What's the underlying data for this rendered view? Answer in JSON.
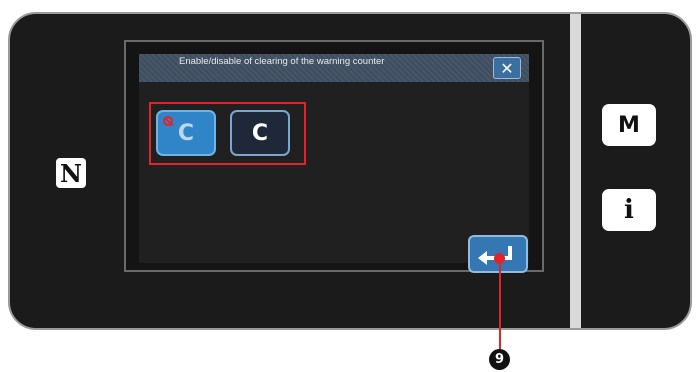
{
  "dialog": {
    "title": "Enable/disable of clearing of the warning counter",
    "close_glyph": "✕"
  },
  "buttons": {
    "enable_clear_label": "C",
    "disable_clear_label": "C",
    "enter_icon": "enter-return-icon"
  },
  "side_panel": {
    "m_label": "M",
    "info_label": "i"
  },
  "nfc_icon": "N",
  "callout": {
    "number": "9"
  },
  "colors": {
    "selection_outline": "#e0242a",
    "button_blue": "#2f85c8",
    "dialog_bar": "#3e4e60"
  }
}
